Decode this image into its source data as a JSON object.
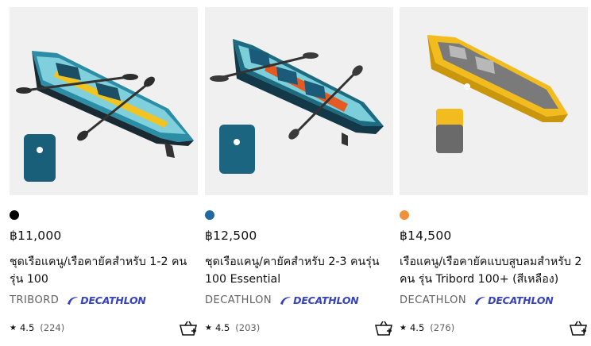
{
  "products": [
    {
      "color_dot": "#000000",
      "price": "฿11,000",
      "title": "ชุดเรือแคนู/เรือคายัคสำหรับ 1-2 คน รุ่น 100",
      "brand": "TRIBORD",
      "logo_text": "DECATHLON",
      "rating": "4.5",
      "review_count": "(224)",
      "cart_icon": "add-to-cart-icon"
    },
    {
      "color_dot": "#1f6aa0",
      "price": "฿12,500",
      "title": "ชุดเรือแคนู/คายัคสำหรับ 2-3 คนรุ่น 100 Essential",
      "brand": "DECATHLON",
      "logo_text": "DECATHLON",
      "rating": "4.5",
      "review_count": "(203)",
      "cart_icon": "add-to-cart-icon"
    },
    {
      "color_dot": "#f0913a",
      "price": "฿14,500",
      "title": "เรือแคนู/เรือคายัคแบบสูบลมสำหรับ 2 คน รุ่น Tribord 100+ (สีเหลือง)",
      "brand": "DECATHLON",
      "logo_text": "DECATHLON",
      "rating": "4.5",
      "review_count": "(276)",
      "cart_icon": "add-to-cart-icon"
    }
  ],
  "colors": {
    "image_bg": "#f0f0f0",
    "brand_blue": "#3643ba",
    "muted_text": "#616161"
  }
}
